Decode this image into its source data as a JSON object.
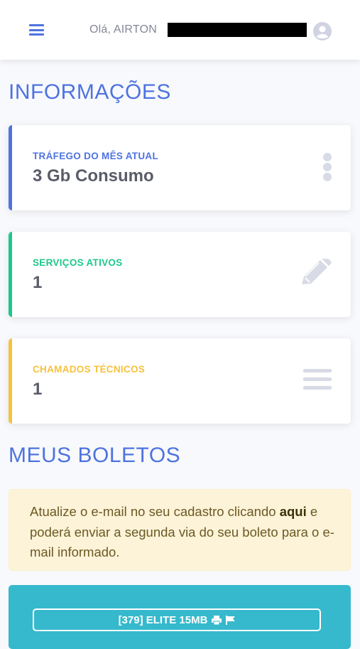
{
  "header": {
    "greeting": "Olá, AIRTON",
    "menu_icon": "hamburger-icon",
    "avatar_icon": "user-circle-icon"
  },
  "sections": {
    "info_title": "INFORMAÇÕES",
    "boletos_title": "MEUS BOLETOS"
  },
  "cards": [
    {
      "label": "TRÁFEGO DO MÊS ATUAL",
      "value": "3 Gb Consumo",
      "icon": "ellipsis-vertical-icon",
      "accent": "#4e73df"
    },
    {
      "label": "SERVIÇOS ATIVOS",
      "value": "1",
      "icon": "pencil-icon",
      "accent": "#1cc88a"
    },
    {
      "label": "CHAMADOS TÉCNICOS",
      "value": "1",
      "icon": "list-icon",
      "accent": "#f6c23e"
    }
  ],
  "alert": {
    "line_start": "Atualize o e-mail no seu cadastro clicando",
    "link": "aqui",
    "line_end": "e poderá enviar a segunda via do seu boleto para o e-mail informado."
  },
  "boleto": {
    "label": "[379] ELITE 15MB",
    "icons": [
      "print-icon",
      "flag-icon"
    ],
    "color": "#36b9cc"
  }
}
